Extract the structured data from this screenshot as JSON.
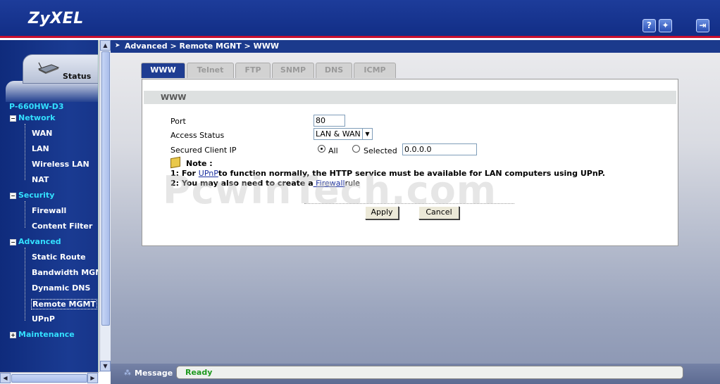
{
  "header": {
    "logo": "ZyXEL",
    "icons": [
      "help-icon",
      "wizard-icon",
      "logout-icon"
    ]
  },
  "sidebar": {
    "status_label": "Status",
    "model": "P-660HW-D3",
    "groups": [
      {
        "label": "Network",
        "expanded": true,
        "items": [
          "WAN",
          "LAN",
          "Wireless LAN",
          "NAT"
        ]
      },
      {
        "label": "Security",
        "expanded": true,
        "items": [
          "Firewall",
          "Content Filter"
        ]
      },
      {
        "label": "Advanced",
        "expanded": true,
        "items": [
          "Static Route",
          "Bandwidth MGMT",
          "Dynamic DNS",
          "Remote MGMT",
          "UPnP"
        ]
      },
      {
        "label": "Maintenance",
        "expanded": false,
        "items": []
      }
    ],
    "selected_item": "Remote MGMT"
  },
  "breadcrumb": "Advanced > Remote MGNT > WWW",
  "tabs": [
    "WWW",
    "Telnet",
    "FTP",
    "SNMP",
    "DNS",
    "ICMP"
  ],
  "active_tab": "WWW",
  "section_title": "WWW",
  "form": {
    "port_label": "Port",
    "port_value": "80",
    "access_label": "Access Status",
    "access_value": "LAN & WAN",
    "secured_label": "Secured Client IP",
    "radio_all": "All",
    "radio_selected": "Selected",
    "selected_ip": "0.0.0.0",
    "selected_option": "All"
  },
  "note": {
    "title": "Note :",
    "line1_prefix": "1: For ",
    "line1_link": "UPnP",
    "line1_suffix": "to function normally, the HTTP service must be available for LAN computers using UPnP.",
    "line2_prefix": "2: You may also need to create a",
    "line2_link": " Firewall",
    "line2_suffix": "rule"
  },
  "buttons": {
    "apply": "Apply",
    "cancel": "Cancel"
  },
  "watermark": "PcwinTech.com",
  "statusbar": {
    "label": "Message",
    "text": "Ready"
  },
  "colors": {
    "header": "#1d3c9a",
    "accent_red": "#c8102e",
    "nav_cyan": "#33e0ff",
    "ready_green": "#1e9a1e"
  }
}
